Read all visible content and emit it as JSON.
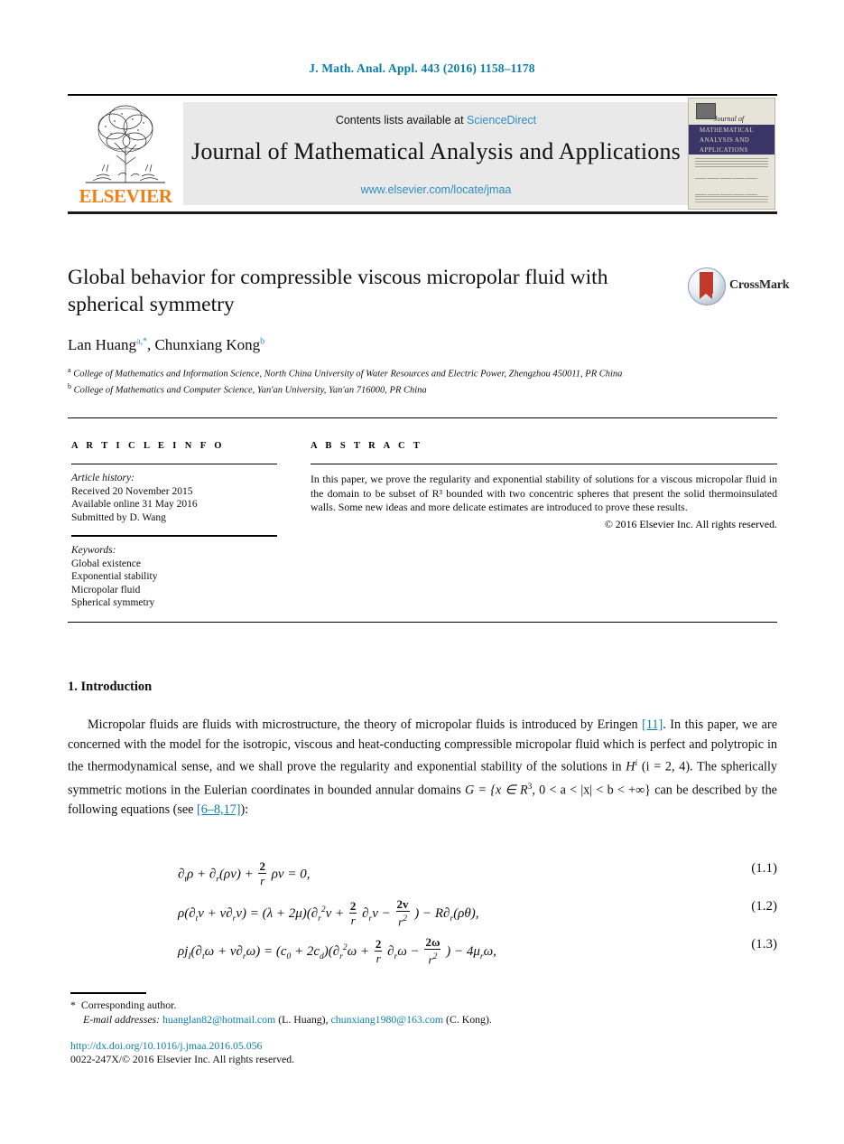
{
  "running_head": "J. Math. Anal. Appl. 443 (2016) 1158–1178",
  "masthead": {
    "contents_prefix": "Contents lists available at ",
    "sciencedirect": "ScienceDirect",
    "journal_title": "Journal of Mathematical Analysis and Applications",
    "journal_url": "www.elsevier.com/locate/jmaa",
    "publisher_wordmark": "ELSEVIER",
    "cover": {
      "journal_of": "Journal of",
      "line1": "MATHEMATICAL",
      "line2": "ANALYSIS AND",
      "line3": "APPLICATIONS"
    }
  },
  "article": {
    "title": "Global behavior for compressible viscous micropolar fluid with spherical symmetry",
    "crossmark_label": "CrossMark",
    "authors_html": "Lan Huang<sup class=\"aff-link\">a</sup><sup class=\"aff-link\">,</sup><sup class=\"aff-link\">*</sup>, Chunxiang Kong<sup class=\"aff-link\">b</sup>",
    "affiliation_a": "College of Mathematics and Information Science, North China University of Water Resources and Electric Power, Zhengzhou 450011, PR China",
    "affiliation_b": "College of Mathematics and Computer Science, Yan'an University, Yan'an 716000, PR China"
  },
  "info": {
    "heading": "A R T I C L E  I N F O",
    "history_label": "Article history:",
    "history": [
      "Received 20 November 2015",
      "Available online 31 May 2016",
      "Submitted by D. Wang"
    ],
    "keywords_label": "Keywords:",
    "keywords": [
      "Global existence",
      "Exponential stability",
      "Micropolar fluid",
      "Spherical symmetry"
    ]
  },
  "abstract": {
    "heading": "A B S T R A C T",
    "text": "In this paper, we prove the regularity and exponential stability of solutions for a viscous micropolar fluid in the domain to be subset of R³ bounded with two concentric spheres that present the solid thermoinsulated walls. Some new ideas and more delicate estimates are introduced to prove these results.",
    "copyright": "© 2016 Elsevier Inc. All rights reserved."
  },
  "body": {
    "section_number_title": "1. Introduction",
    "citation_eringen": "[11]",
    "citation_equations": "[6–8,17]",
    "paragraph_part1": "Micropolar fluids are fluids with microstructure, the theory of micropolar fluids is introduced by Eringen ",
    "paragraph_part2": ". In this paper, we are concerned with the model for the isotropic, viscous and heat-conducting compressible micropolar fluid which is perfect and polytropic in the thermodynamical sense, and we shall prove the regularity and exponential stability of the solutions in ",
    "paragraph_math1": "H",
    "paragraph_math1_sup": "i",
    "paragraph_part3": " (i = 2, 4). The spherically symmetric motions in the Eulerian coordinates in bounded annular domains ",
    "paragraph_math2": "G = {x ∈ R",
    "paragraph_math2_sup": "3",
    "paragraph_part4": ", 0 < a < |x| < b < +∞} can be described by the following equations (see ",
    "paragraph_part5": "):"
  },
  "equations": [
    {
      "number": "(1.1)"
    },
    {
      "number": "(1.2)"
    },
    {
      "number": "(1.3)"
    }
  ],
  "footnote": {
    "star": "*",
    "corresponding": "Corresponding author.",
    "email_label": "E-mail addresses:",
    "email1": "huanglan82@hotmail.com",
    "email1_owner": "(L. Huang)",
    "email2": "chunxiang1980@163.com",
    "email2_owner": "(C. Kong)."
  },
  "doi": "http://dx.doi.org/10.1016/j.jmaa.2016.05.056",
  "issn_line": "0022-247X/© 2016 Elsevier Inc. All rights reserved.",
  "colors": {
    "link_teal": "#0b7eab",
    "link_blue": "#2b8fc4",
    "elsevier_orange": "#f07f17",
    "band_gray": "#e9e9e9",
    "cover_navy": "#3a3566"
  }
}
